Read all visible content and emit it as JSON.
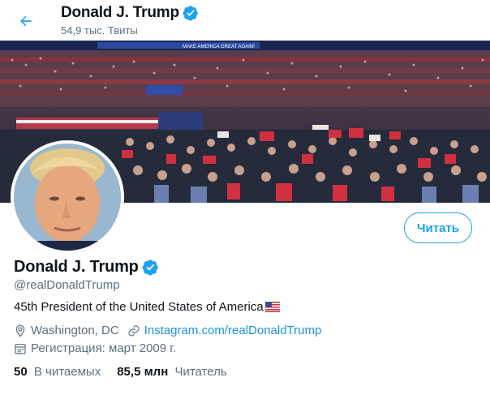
{
  "header": {
    "back_icon": "arrow-left-icon",
    "name": "Donald J. Trump",
    "tweet_count": "54,9 тыс. Твиты"
  },
  "banner": {
    "description_icon": "rally-crowd-photo",
    "sign_text": "MAKE AMERICA GREAT AGAIN!"
  },
  "profile": {
    "name": "Donald J. Trump",
    "handle": "@realDonaldTrump",
    "bio": "45th President of the United States of America",
    "bio_emoji": "us-flag-icon",
    "location": "Washington, DC",
    "link": "Instagram.com/realDonaldTrump",
    "joined": "Регистрация: март 2009 г.",
    "verified_icon": "verified-badge-icon"
  },
  "actions": {
    "follow_label": "Читать"
  },
  "stats": {
    "following_count": "50",
    "following_label": "В читаемых",
    "followers_count": "85,5 млн",
    "followers_label": "Читатель"
  },
  "colors": {
    "accent": "#1da1f2",
    "link": "#1b95e0",
    "secondary_text": "#5b7083",
    "primary_text": "#0f1419"
  }
}
